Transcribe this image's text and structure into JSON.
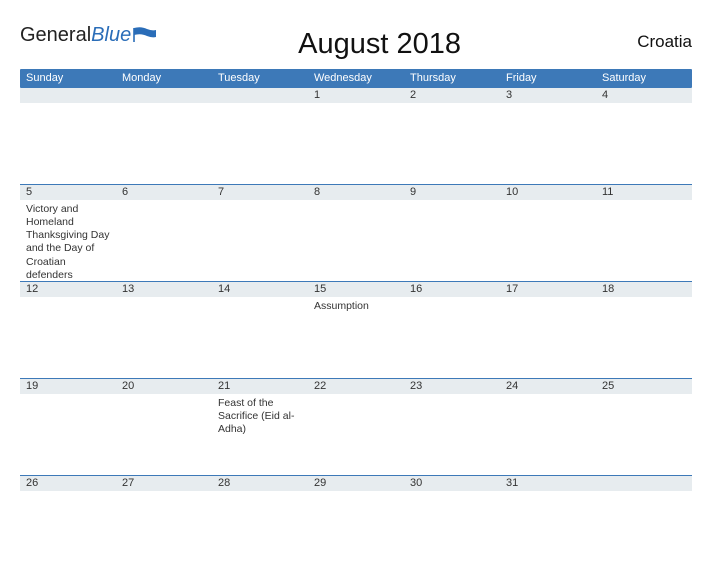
{
  "brand": {
    "name_part1": "General",
    "name_part2": "Blue"
  },
  "title": "August 2018",
  "country": "Croatia",
  "day_headers": [
    "Sunday",
    "Monday",
    "Tuesday",
    "Wednesday",
    "Thursday",
    "Friday",
    "Saturday"
  ],
  "weeks": [
    {
      "band": [
        "",
        "",
        "",
        "1",
        "2",
        "3",
        "4"
      ],
      "cells": [
        {
          "num": "",
          "event": ""
        },
        {
          "num": "",
          "event": ""
        },
        {
          "num": "",
          "event": ""
        },
        {
          "num": "",
          "event": ""
        },
        {
          "num": "",
          "event": ""
        },
        {
          "num": "",
          "event": ""
        },
        {
          "num": "",
          "event": ""
        }
      ]
    },
    {
      "band": [
        "5",
        "6",
        "7",
        "8",
        "9",
        "10",
        "11"
      ],
      "cells": [
        {
          "num": "",
          "event": "Victory and Homeland Thanksgiving Day and the Day of Croatian defenders"
        },
        {
          "num": "",
          "event": ""
        },
        {
          "num": "",
          "event": ""
        },
        {
          "num": "",
          "event": ""
        },
        {
          "num": "",
          "event": ""
        },
        {
          "num": "",
          "event": ""
        },
        {
          "num": "",
          "event": ""
        }
      ]
    },
    {
      "band": [
        "12",
        "13",
        "14",
        "15",
        "16",
        "17",
        "18"
      ],
      "cells": [
        {
          "num": "",
          "event": ""
        },
        {
          "num": "",
          "event": ""
        },
        {
          "num": "",
          "event": ""
        },
        {
          "num": "",
          "event": "Assumption"
        },
        {
          "num": "",
          "event": ""
        },
        {
          "num": "",
          "event": ""
        },
        {
          "num": "",
          "event": ""
        }
      ]
    },
    {
      "band": [
        "19",
        "20",
        "21",
        "22",
        "23",
        "24",
        "25"
      ],
      "cells": [
        {
          "num": "",
          "event": ""
        },
        {
          "num": "",
          "event": ""
        },
        {
          "num": "",
          "event": "Feast of the Sacrifice (Eid al-Adha)"
        },
        {
          "num": "",
          "event": ""
        },
        {
          "num": "",
          "event": ""
        },
        {
          "num": "",
          "event": ""
        },
        {
          "num": "",
          "event": ""
        }
      ]
    },
    {
      "band": [
        "26",
        "27",
        "28",
        "29",
        "30",
        "31",
        ""
      ],
      "cells": [
        {
          "num": "",
          "event": ""
        },
        {
          "num": "",
          "event": ""
        },
        {
          "num": "",
          "event": ""
        },
        {
          "num": "",
          "event": ""
        },
        {
          "num": "",
          "event": ""
        },
        {
          "num": "",
          "event": ""
        },
        {
          "num": "",
          "event": ""
        }
      ]
    }
  ]
}
